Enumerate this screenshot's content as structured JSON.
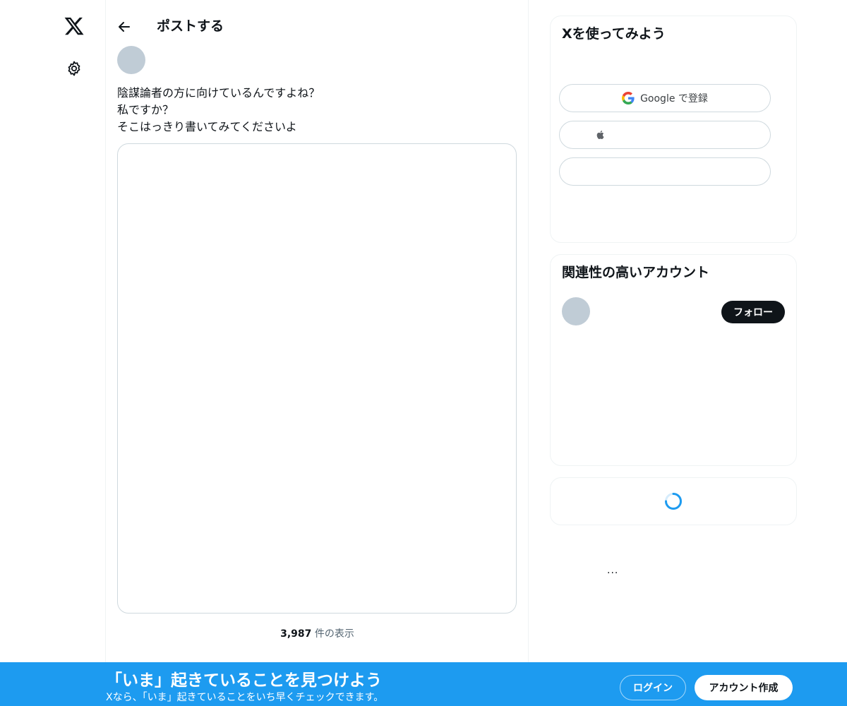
{
  "nav": {
    "logo_icon": "x-logo-icon",
    "settings_icon": "gear-icon"
  },
  "header": {
    "back_icon": "arrow-left-icon",
    "title": "ポストする"
  },
  "post": {
    "lines": [
      "陰謀論者の方に向けているんですよね？",
      "私ですか？",
      "そこはっきり書いてみてくださいよ"
    ],
    "views_count": "3,987",
    "views_label": " 件の表示"
  },
  "signup_card": {
    "title": "Xを使ってみよう",
    "google_label": "Google で登録",
    "google_icon": "google-icon",
    "apple_icon": "apple-icon"
  },
  "related_card": {
    "title": "関連性の高いアカウント",
    "follow_label": "フォロー"
  },
  "loading": {
    "spinner_icon": "loading-spinner-icon"
  },
  "more": "...",
  "bottom_bar": {
    "headline": "「いま」起きていることを見つけよう",
    "subline": "Xなら、「いま」起きていることをいち早くチェックできます。",
    "login_label": "ログイン",
    "signup_label": "アカウント作成"
  },
  "colors": {
    "accent": "#1d9bf0",
    "text": "#0f1419",
    "border": "#eff3f4",
    "avatar_placeholder": "#c0ccd6"
  }
}
